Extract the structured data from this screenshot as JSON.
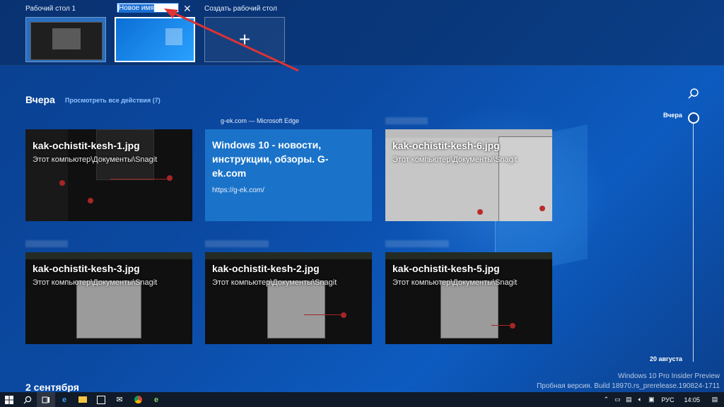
{
  "desktops": {
    "desktop1_label": "Рабочий стол 1",
    "rename_value": "Новое имя",
    "new_desktop_label": "Создать рабочий стол"
  },
  "timeline": {
    "section_title": "Вчера",
    "see_all_link": "Просмотреть все действия (7)",
    "next_section_title": "2 сентября",
    "scrubber_top_label": "Вчера",
    "scrubber_bottom_label": "20 августа"
  },
  "cards": [
    {
      "title": "kak-ochistit-kesh-1.jpg",
      "path": "Этот компьютер\\Документы\\Snagit"
    },
    {
      "app": "g-ek.com — Microsoft Edge",
      "title": "Windows 10 - новости, инструкции, обзоры. G-ek.com",
      "url": "https://g-ek.com/"
    },
    {
      "title": "kak-ochistit-kesh-6.jpg",
      "path": "Этот компьютер\\Документы\\Snagit"
    },
    {
      "title": "kak-ochistit-kesh-3.jpg",
      "path": "Этот компьютер\\Документы\\Snagit"
    },
    {
      "title": "kak-ochistit-kesh-2.jpg",
      "path": "Этот компьютер\\Документы\\Snagit"
    },
    {
      "title": "kak-ochistit-kesh-5.jpg",
      "path": "Этот компьютер\\Документы\\Snagit"
    }
  ],
  "watermark": {
    "line1": "Windows 10 Pro Insider Preview",
    "line2": "Пробная версия. Build 18970.rs_prerelease.190824-1711"
  },
  "taskbar": {
    "lang": "РУС",
    "time": "14:05"
  },
  "colors": {
    "accent": "#1a73c9",
    "annotation_red": "#d33"
  }
}
